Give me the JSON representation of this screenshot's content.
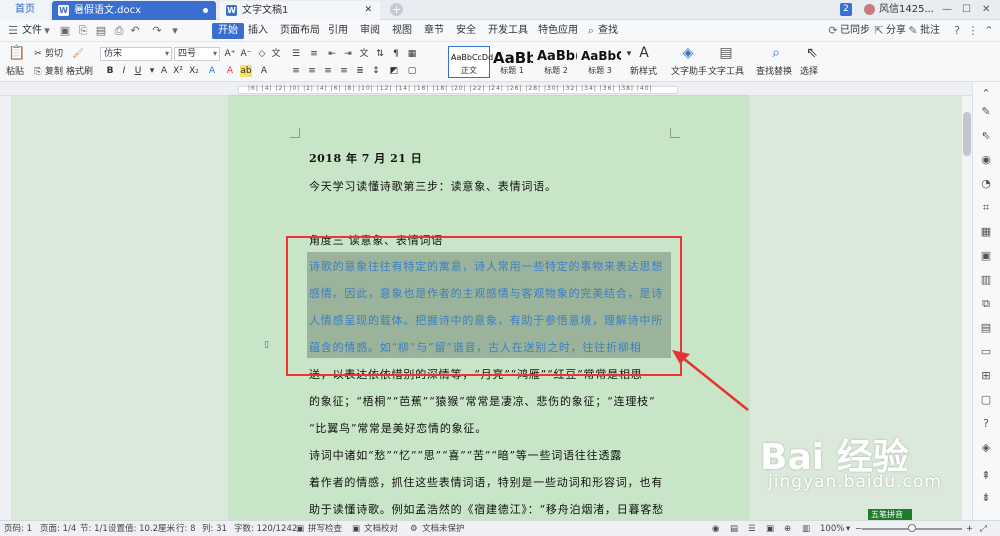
{
  "tabs": {
    "home": "首页",
    "doc1": "暑假语文.docx",
    "doc2": "文字文稿1",
    "badge": "2",
    "user": "风信1425...",
    "doc_icon": "W"
  },
  "menu": {
    "file": "文件",
    "items": [
      "开始",
      "插入",
      "页面布局",
      "引用",
      "审阅",
      "视图",
      "章节",
      "安全",
      "开发工具",
      "特色应用"
    ],
    "search": "查找",
    "sync": "已同步",
    "share": "分享",
    "annotate": "批注"
  },
  "ribbon": {
    "cut": "剪切",
    "copy": "复制",
    "paste": "粘贴",
    "format_painter": "格式刷",
    "font": "仿宋",
    "size": "四号",
    "styles": [
      {
        "preview": "AaBbCcDd",
        "name": "正文"
      },
      {
        "preview": "AaBb",
        "name": "标题 1"
      },
      {
        "preview": "AaBb(",
        "name": "标题 2"
      },
      {
        "preview": "AaBbC",
        "name": "标题 3"
      }
    ],
    "new_style": "新样式",
    "doc_helper": "文字助手",
    "text_tools": "文字工具",
    "find_replace": "查找替换",
    "select": "选择"
  },
  "document": {
    "date": "2018 年 7 月 21 日",
    "line2": "今天学习读懂诗歌第三步：读意象、表情词语。",
    "heading": "角度三  读意象、表情词语",
    "highlight": [
      "诗歌的意象往往有特定的寓意，诗人常用一些特定的事物来表达思想",
      "感情。因此，意象也是作者的主观感情与客观物象的完美结合，是诗",
      "人情感呈现的载体。把握诗中的意象，有助于参悟意境，理解诗中所",
      "蕴含的情感。如“柳”与“留”谐音，古人在送别之时，往往折柳相"
    ],
    "rest": [
      "送，以表达依依惜别的深情等，“月亮”“鸿雁”“红豆”常常是相思",
      "的象征；“梧桐”“芭蕉”“猿猴”常常是凄凉、悲伤的象征；“连理枝”",
      "“比翼鸟”常常是美好恋情的象征。",
      "诗词中诸如“愁”“忆”“思”“喜”“苦”“暗”等一些词语往往透露",
      "着作者的情感，抓住这些表情词语，特别是一些动词和形容词，也有",
      "助于读懂诗歌。例如孟浩然的《宿建德江》：“移舟泊烟渚，日暮客愁"
    ]
  },
  "watermark": {
    "main": "Bai 经验",
    "sub": "jingyan.baidu.com"
  },
  "ime": "五笔拼音",
  "status": {
    "page_num": "页码: 1",
    "page": "页面: 1/4",
    "section": "节: 1/1",
    "setting": "设置值: 10.2厘米",
    "row": "行: 8",
    "col": "列: 31",
    "words": "字数: 120/1242",
    "spell": "拼写检查",
    "proof": "文档校对",
    "protect": "文档未保护",
    "zoom": "100%"
  },
  "colors": {
    "accent": "#3a6fd1",
    "highlight_bg": "#9bb39a",
    "highlight_text": "#3b7fc4",
    "annotation_red": "#e33333",
    "page_bg": "#c9e5c7"
  }
}
